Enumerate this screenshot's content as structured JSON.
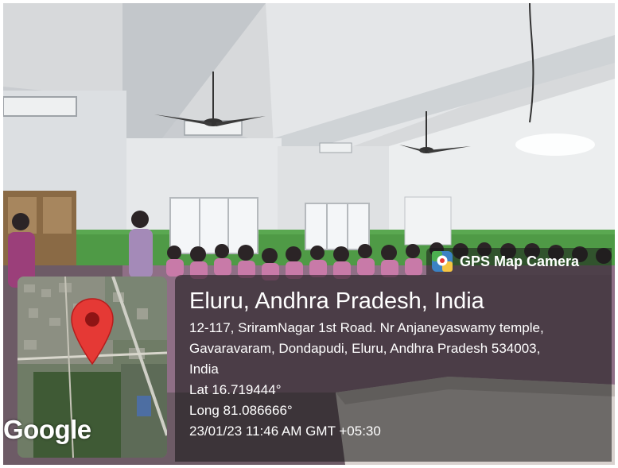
{
  "badge": {
    "app_name": "GPS Map Camera",
    "icon": "gps-map-camera-app-icon"
  },
  "location": {
    "title": "Eluru, Andhra Pradesh, India",
    "address_line1": "12-117, SriramNagar 1st Road. Nr Anjaneyaswamy temple,",
    "address_line2": "Gavaravaram, Dondapudi, Eluru, Andhra Pradesh 534003,",
    "address_line3": "India",
    "latitude": "Lat 16.719444°",
    "longitude": "Long 81.086666°",
    "datetime": "23/01/23 11:46 AM GMT +05:30"
  },
  "map": {
    "logo_text": "Google",
    "pin_icon": "map-pin-icon",
    "pin_color": "#e53935"
  },
  "colors": {
    "overlay": "#141414",
    "text": "#ffffff",
    "wall_green": "#4f9a46",
    "uniform_pink": "#c87aa8"
  }
}
